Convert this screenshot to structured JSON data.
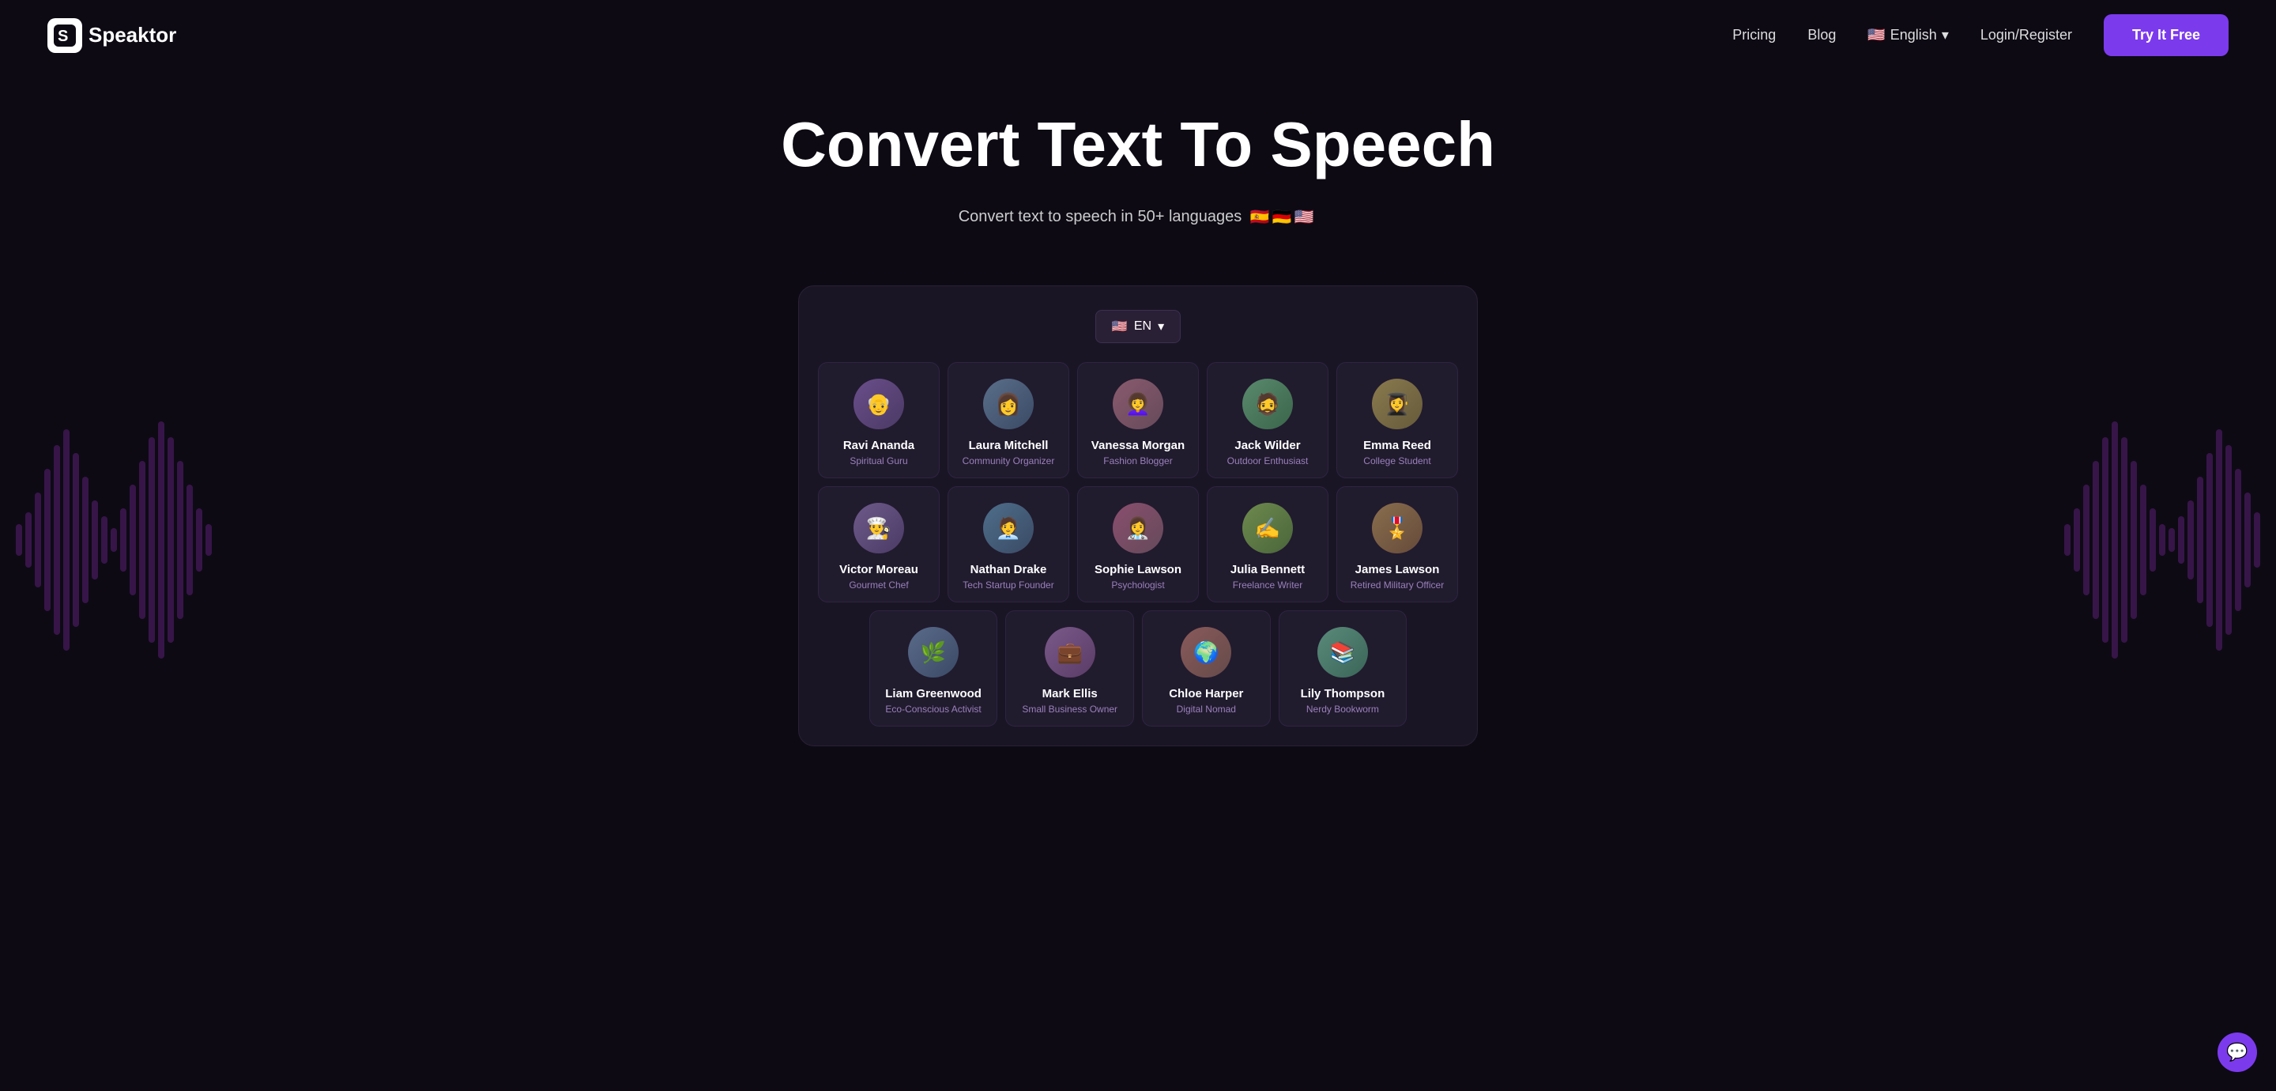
{
  "brand": {
    "name": "Speaktor",
    "logo_symbol": "S"
  },
  "nav": {
    "pricing_label": "Pricing",
    "blog_label": "Blog",
    "language_label": "English",
    "language_code": "EN",
    "login_label": "Login/Register",
    "try_button": "Try It Free"
  },
  "hero": {
    "title": "Convert Text To Speech",
    "subtitle": "Convert text to speech in 50+ languages",
    "flags": [
      "🇪🇸",
      "🇩🇪",
      "🇺🇸"
    ]
  },
  "app": {
    "lang_selector": "EN",
    "voices_row1": [
      {
        "name": "Ravi Ananda",
        "role": "Spiritual Guru",
        "emoji": "👴"
      },
      {
        "name": "Laura Mitchell",
        "role": "Community Organizer",
        "emoji": "👩"
      },
      {
        "name": "Vanessa Morgan",
        "role": "Fashion Blogger",
        "emoji": "👩‍🦱"
      },
      {
        "name": "Jack Wilder",
        "role": "Outdoor Enthusiast",
        "emoji": "🧔"
      },
      {
        "name": "Emma Reed",
        "role": "College Student",
        "emoji": "👩‍🎓"
      }
    ],
    "voices_row2": [
      {
        "name": "Victor Moreau",
        "role": "Gourmet Chef",
        "emoji": "👨‍🍳"
      },
      {
        "name": "Nathan Drake",
        "role": "Tech Startup Founder",
        "emoji": "🧑‍💼"
      },
      {
        "name": "Sophie Lawson",
        "role": "Psychologist",
        "emoji": "👩‍⚕️"
      },
      {
        "name": "Julia Bennett",
        "role": "Freelance Writer",
        "emoji": "✍️"
      },
      {
        "name": "James Lawson",
        "role": "Retired Military Officer",
        "emoji": "🎖️"
      }
    ],
    "voices_row3": [
      {
        "name": "Liam Greenwood",
        "role": "Eco-Conscious Activist",
        "emoji": "🌿"
      },
      {
        "name": "Mark Ellis",
        "role": "Small Business Owner",
        "emoji": "💼"
      },
      {
        "name": "Chloe Harper",
        "role": "Digital Nomad",
        "emoji": "🌍"
      },
      {
        "name": "Lily Thompson",
        "role": "Nerdy Bookworm",
        "emoji": "📚"
      }
    ]
  },
  "chat": {
    "icon": "💬"
  }
}
